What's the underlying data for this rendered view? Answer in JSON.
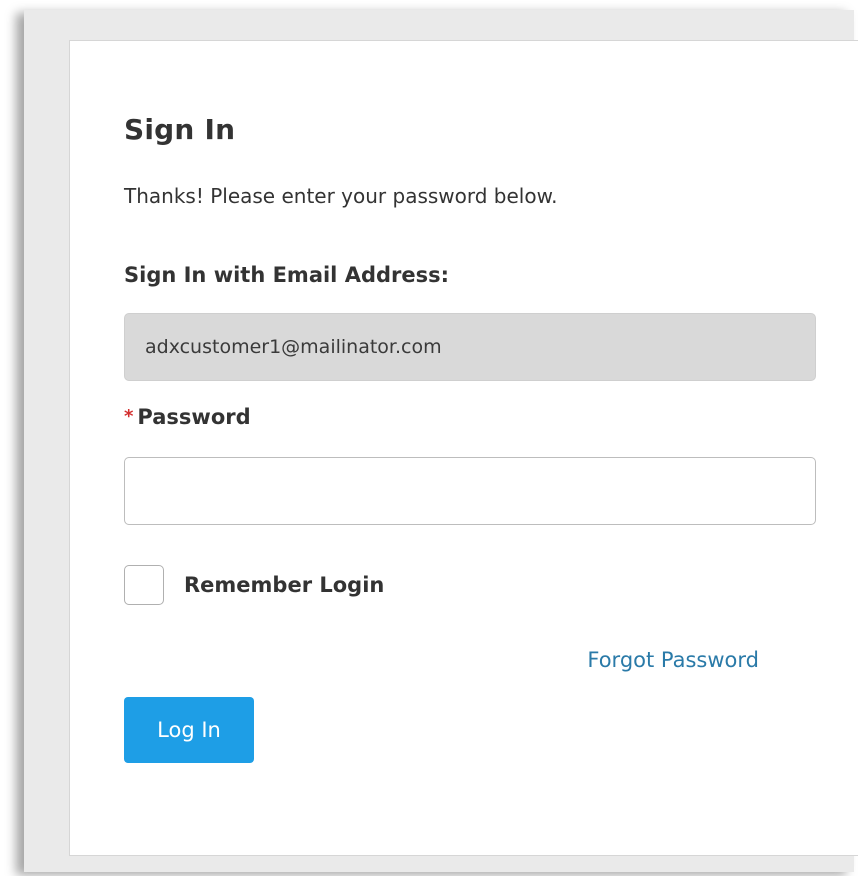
{
  "signin": {
    "title": "Sign In",
    "subtitle": "Thanks! Please enter your password below.",
    "email_label": "Sign In with Email Address:",
    "email_value": "adxcustomer1@mailinator.com",
    "required_marker": "*",
    "password_label": "Password",
    "password_placeholder": "",
    "remember_label": "Remember Login",
    "forgot_label": "Forgot Password",
    "login_label": "Log In"
  },
  "colors": {
    "button": "#1e9ee6",
    "link": "#2a7aa8",
    "required": "#d32f2f",
    "disabled_field": "#d9d9d9"
  }
}
